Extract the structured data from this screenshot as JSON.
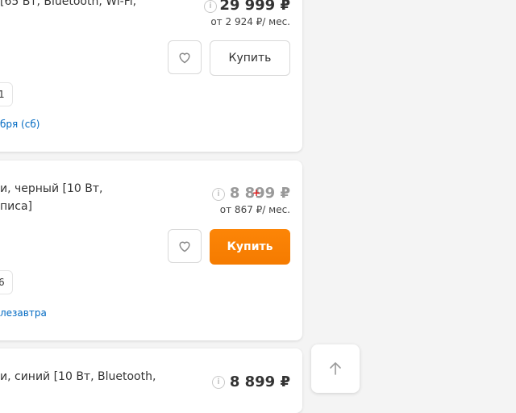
{
  "products": [
    {
      "title_fragment": "[65 Вт, Bluetooth, Wi-Fi,",
      "price": "29 999 ₽",
      "credit": "от 2 924 ₽/ мес.",
      "buy_label": "Купить",
      "badge_fragment": "1",
      "delivery_fragment": "бря (сб)"
    },
    {
      "title_line1": "и, черный [10 Вт,",
      "title_line2": "писа]",
      "price": "8 899 ₽",
      "credit": "от 867 ₽/ мес.",
      "buy_label": "Купить",
      "badge_fragment": "6",
      "delivery_fragment": "лезавтра"
    },
    {
      "title_fragment": "и, синий [10 Вт, Bluetooth,",
      "price": "8 899 ₽"
    }
  ],
  "colors": {
    "accent_orange": "#fc8507",
    "link_blue": "#0069c2"
  },
  "icons": {
    "info": "info-icon",
    "favorite": "heart-icon",
    "scroll_top": "arrow-up-icon"
  }
}
